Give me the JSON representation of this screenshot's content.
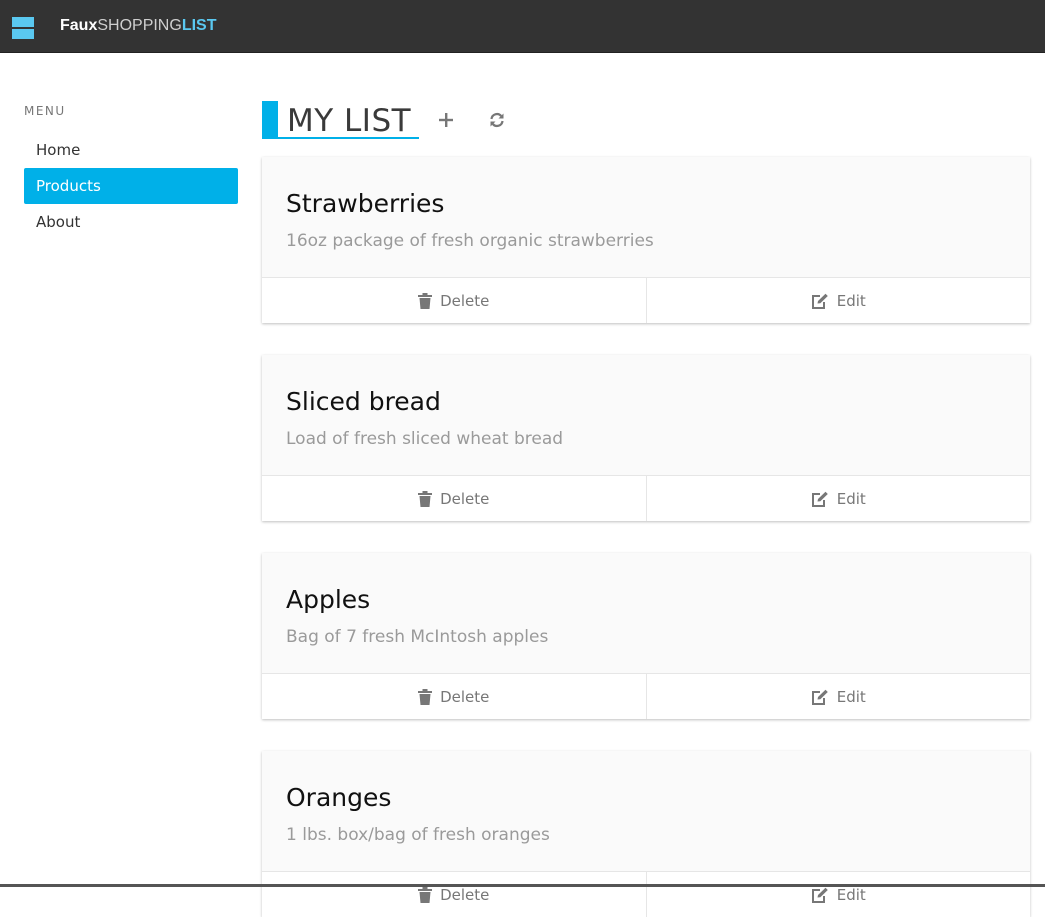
{
  "app": {
    "brand_part1": "Faux",
    "brand_part2": "SHOPPING",
    "brand_part3": "LIST",
    "accent_color": "#00b0e8"
  },
  "sidebar": {
    "menu_label": "MENU",
    "items": [
      {
        "label": "Home",
        "active": false
      },
      {
        "label": "Products",
        "active": true
      },
      {
        "label": "About",
        "active": false
      }
    ]
  },
  "main": {
    "title": "MY LIST",
    "add_icon": "plus-icon",
    "refresh_icon": "refresh-icon",
    "products": [
      {
        "name": "Strawberries",
        "description": "16oz package of fresh organic strawberries",
        "delete_label": "Delete",
        "edit_label": "Edit"
      },
      {
        "name": "Sliced bread",
        "description": "Load of fresh sliced wheat bread",
        "delete_label": "Delete",
        "edit_label": "Edit"
      },
      {
        "name": "Apples",
        "description": "Bag of 7 fresh McIntosh apples",
        "delete_label": "Delete",
        "edit_label": "Edit"
      },
      {
        "name": "Oranges",
        "description": "1 lbs. box/bag of fresh oranges",
        "delete_label": "Delete",
        "edit_label": "Edit"
      }
    ]
  }
}
